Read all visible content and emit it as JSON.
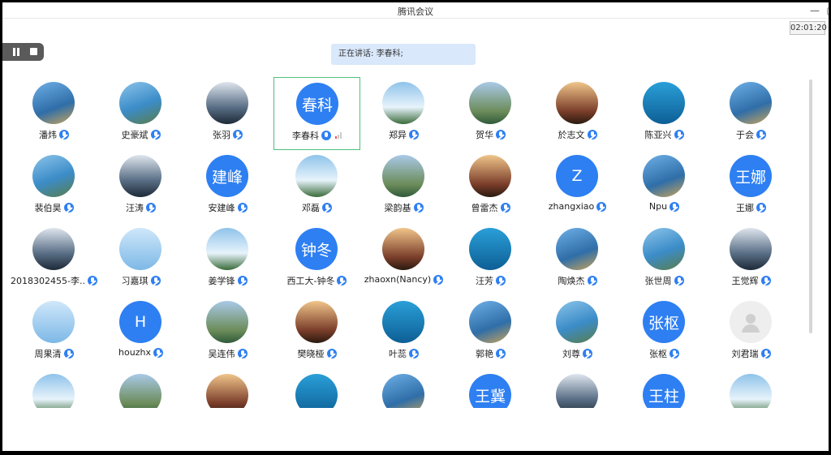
{
  "window": {
    "title": "腾讯会议",
    "minimize_icon": "minimize-icon",
    "maximize_icon": "maximize-icon"
  },
  "timer": "02:01:20",
  "speaking": {
    "prefix": "正在讲话:",
    "names": "李春科;"
  },
  "colors": {
    "accent": "#2e7ff2",
    "active_border": "#4ec07a",
    "speaking_bg": "#d9e8fb"
  },
  "participants": [
    {
      "name": "潘炜",
      "avatar": "photo"
    },
    {
      "name": "史豪斌",
      "avatar": "photo"
    },
    {
      "name": "张羽",
      "avatar": "photo"
    },
    {
      "name": "李春科",
      "avatar": "text",
      "text": "春科",
      "active": true
    },
    {
      "name": "郑异",
      "avatar": "photo"
    },
    {
      "name": "贺华",
      "avatar": "photo"
    },
    {
      "name": "於志文",
      "avatar": "photo"
    },
    {
      "name": "陈亚兴",
      "avatar": "photo"
    },
    {
      "name": "于会",
      "avatar": "photo"
    },
    {
      "name": "裴伯昊",
      "avatar": "photo"
    },
    {
      "name": "汪涛",
      "avatar": "photo"
    },
    {
      "name": "安建峰",
      "avatar": "text",
      "text": "建峰"
    },
    {
      "name": "邓磊",
      "avatar": "photo"
    },
    {
      "name": "梁韵基",
      "avatar": "photo"
    },
    {
      "name": "曾雷杰",
      "avatar": "photo"
    },
    {
      "name": "zhangxiao",
      "avatar": "text",
      "text": "Z"
    },
    {
      "name": "Npu",
      "avatar": "photo"
    },
    {
      "name": "王娜",
      "avatar": "text",
      "text": "王娜"
    },
    {
      "name": "2018302455-李...",
      "avatar": "photo"
    },
    {
      "name": "习嘉琪",
      "avatar": "photo"
    },
    {
      "name": "姜学锋",
      "avatar": "photo"
    },
    {
      "name": "西工大-钟冬",
      "avatar": "text",
      "text": "钟冬"
    },
    {
      "name": "zhaoxn(Nancy)",
      "avatar": "photo"
    },
    {
      "name": "汪芳",
      "avatar": "photo"
    },
    {
      "name": "陶焕杰",
      "avatar": "photo"
    },
    {
      "name": "张世周",
      "avatar": "photo"
    },
    {
      "name": "王觉辉",
      "avatar": "photo"
    },
    {
      "name": "周果清",
      "avatar": "photo"
    },
    {
      "name": "houzhx",
      "avatar": "text",
      "text": "H"
    },
    {
      "name": "吴连伟",
      "avatar": "photo"
    },
    {
      "name": "樊晓桠",
      "avatar": "photo"
    },
    {
      "name": "叶蕊",
      "avatar": "photo"
    },
    {
      "name": "郭艳",
      "avatar": "photo"
    },
    {
      "name": "刘尊",
      "avatar": "photo"
    },
    {
      "name": "张枢",
      "avatar": "text",
      "text": "张枢"
    },
    {
      "name": "刘君瑞",
      "avatar": "default"
    },
    {
      "name": "",
      "avatar": "photo"
    },
    {
      "name": "",
      "avatar": "photo"
    },
    {
      "name": "",
      "avatar": "photo"
    },
    {
      "name": "",
      "avatar": "photo"
    },
    {
      "name": "",
      "avatar": "photo"
    },
    {
      "name": "",
      "avatar": "text",
      "text": "王冀"
    },
    {
      "name": "",
      "avatar": "photo"
    },
    {
      "name": "",
      "avatar": "text",
      "text": "王柱"
    },
    {
      "name": "",
      "avatar": "photo"
    }
  ]
}
